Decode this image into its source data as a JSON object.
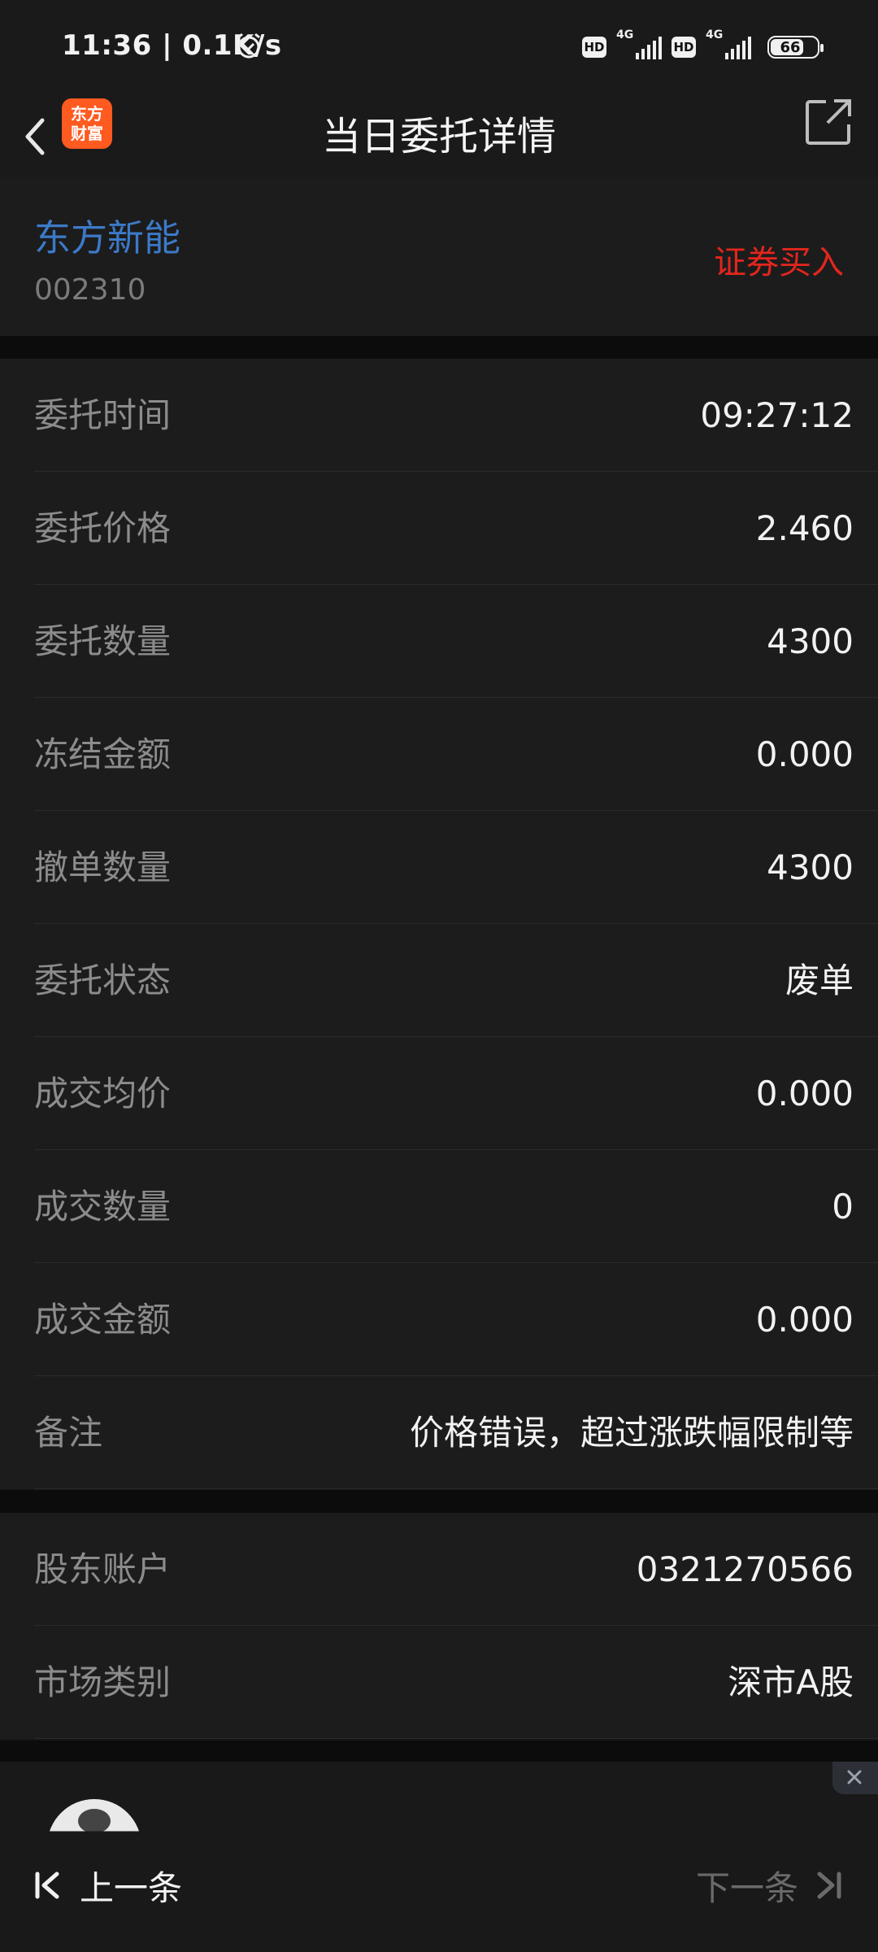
{
  "status_bar": {
    "time": "11:36 | 0.1K/s",
    "hd1": "HD",
    "net1": "4G",
    "hd2": "HD",
    "net2": "4G",
    "battery": "66"
  },
  "header": {
    "title": "当日委托详情",
    "logo_line1": "东方",
    "logo_line2": "财富"
  },
  "stock": {
    "name": "东方新能",
    "code": "002310",
    "trade_type": "证券买入"
  },
  "details": [
    {
      "label": "委托时间",
      "value": "09:27:12"
    },
    {
      "label": "委托价格",
      "value": "2.460"
    },
    {
      "label": "委托数量",
      "value": "4300"
    },
    {
      "label": "冻结金额",
      "value": "0.000"
    },
    {
      "label": "撤单数量",
      "value": "4300"
    },
    {
      "label": "委托状态",
      "value": "废单"
    },
    {
      "label": "成交均价",
      "value": "0.000"
    },
    {
      "label": "成交数量",
      "value": "0"
    },
    {
      "label": "成交金额",
      "value": "0.000"
    },
    {
      "label": "备注",
      "value": "价格错误，超过涨跌幅限制等"
    }
  ],
  "account": [
    {
      "label": "股东账户",
      "value": "0321270566"
    },
    {
      "label": "市场类别",
      "value": "深市A股"
    }
  ],
  "footer": {
    "prev_label": "上一条",
    "next_label": "下一条"
  },
  "colors": {
    "background": "#161616",
    "stock_name": "#3c7ac8",
    "trade_type": "#e3261d",
    "logo": "#ff5a1f"
  },
  "icons": [
    "back-arrow-icon",
    "share-icon",
    "alarm-icon",
    "first-page-icon",
    "last-page-icon",
    "close-icon"
  ]
}
